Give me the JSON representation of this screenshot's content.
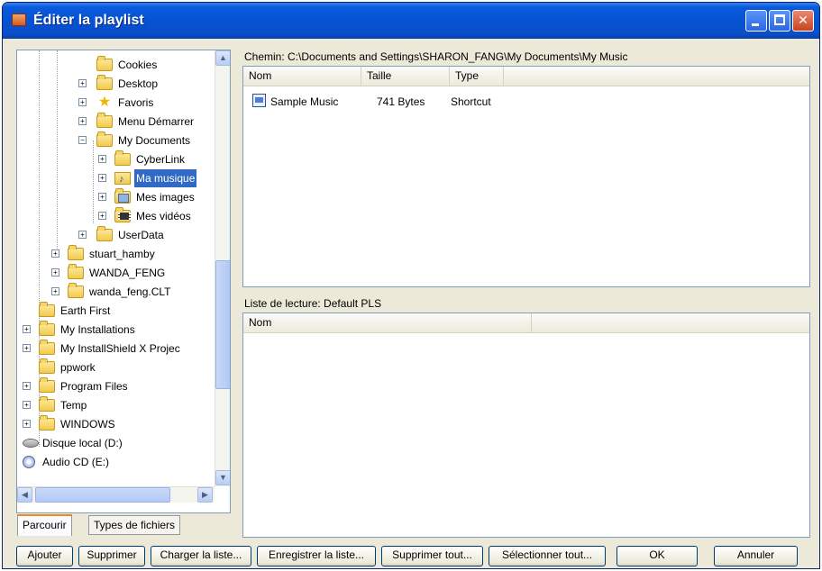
{
  "window": {
    "title": "Éditer la playlist"
  },
  "tree": {
    "items": [
      {
        "label": "Cookies",
        "icon": "folder-icon"
      },
      {
        "label": "Desktop",
        "icon": "folder-icon"
      },
      {
        "label": "Favoris",
        "icon": "star-folder-icon"
      },
      {
        "label": "Menu Démarrer",
        "icon": "folder-icon"
      },
      {
        "label": "My Documents",
        "icon": "folder-open-icon"
      },
      {
        "label": "CyberLink",
        "icon": "folder-icon"
      },
      {
        "label": "Ma musique",
        "icon": "music-folder-icon",
        "selected": true
      },
      {
        "label": "Mes images",
        "icon": "pictures-folder-icon"
      },
      {
        "label": "Mes vidéos",
        "icon": "videos-folder-icon"
      },
      {
        "label": "UserData",
        "icon": "folder-icon"
      },
      {
        "label": "stuart_hamby",
        "icon": "folder-icon"
      },
      {
        "label": "WANDA_FENG",
        "icon": "folder-icon"
      },
      {
        "label": "wanda_feng.CLT",
        "icon": "folder-icon"
      },
      {
        "label": "Earth First",
        "icon": "folder-icon"
      },
      {
        "label": "My Installations",
        "icon": "folder-icon"
      },
      {
        "label": "My InstallShield X Projec",
        "icon": "folder-icon"
      },
      {
        "label": "ppwork",
        "icon": "folder-icon"
      },
      {
        "label": "Program Files",
        "icon": "folder-icon"
      },
      {
        "label": "Temp",
        "icon": "folder-icon"
      },
      {
        "label": "WINDOWS",
        "icon": "folder-icon"
      },
      {
        "label": "Disque local (D:)",
        "icon": "drive-icon"
      },
      {
        "label": "Audio CD (E:)",
        "icon": "cd-icon"
      }
    ]
  },
  "tabs": [
    {
      "label": "Parcourir",
      "active": true
    },
    {
      "label": "Types de fichiers",
      "active": false
    }
  ],
  "files": {
    "path_label": "Chemin: C:\\Documents and Settings\\SHARON_FANG\\My Documents\\My Music",
    "columns": [
      "Nom",
      "Taille",
      "Type"
    ],
    "rows": [
      {
        "name": "Sample Music",
        "size": "741 Bytes",
        "type": "Shortcut",
        "icon": "shortcut-icon"
      }
    ]
  },
  "playlist": {
    "label": "Liste de lecture: Default PLS",
    "columns": [
      "Nom"
    ]
  },
  "buttons": {
    "add": "Ajouter",
    "remove": "Supprimer",
    "load": "Charger la liste...",
    "save": "Enregistrer la liste...",
    "remove_all": "Supprimer tout...",
    "select_all": "Sélectionner tout...",
    "ok": "OK",
    "cancel": "Annuler"
  }
}
